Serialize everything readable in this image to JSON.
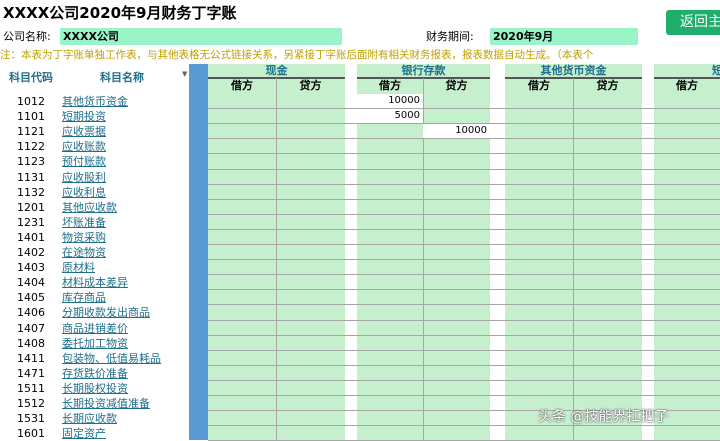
{
  "title": "XXXX公司2020年9月财务丁字账",
  "return_button": "返回主",
  "company_label": "公司名称:",
  "company_value": "XXXX公司",
  "period_label": "财务期间:",
  "period_value": "2020年9月",
  "notice": "注：本表为丁字账单独工作表，与其他表格无公式链接关系，另紧接丁字账后面附有相关财务报表，报表数据自动生成。（本表个",
  "headers": {
    "code": "科目代码",
    "name": "科目名称",
    "groups": [
      "现金",
      "银行存款",
      "其他货币资金",
      "短期"
    ],
    "debit": "借方",
    "credit": "贷方"
  },
  "accounts": [
    {
      "code": "1012",
      "name": "其他货币资金"
    },
    {
      "code": "1101",
      "name": "短期投资"
    },
    {
      "code": "1121",
      "name": "应收票据"
    },
    {
      "code": "1122",
      "name": "应收账款"
    },
    {
      "code": "1123",
      "name": "预付账款"
    },
    {
      "code": "1131",
      "name": "应收股利"
    },
    {
      "code": "1132",
      "name": "应收利息"
    },
    {
      "code": "1201",
      "name": "其他应收款"
    },
    {
      "code": "1231",
      "name": "坏账准备"
    },
    {
      "code": "1401",
      "name": "物资采购"
    },
    {
      "code": "1402",
      "name": "在途物资"
    },
    {
      "code": "1403",
      "name": "原材料"
    },
    {
      "code": "1404",
      "name": "材料成本差异"
    },
    {
      "code": "1405",
      "name": "库存商品"
    },
    {
      "code": "1406",
      "name": "分期收款发出商品"
    },
    {
      "code": "1407",
      "name": "商品进销差价"
    },
    {
      "code": "1408",
      "name": "委托加工物资"
    },
    {
      "code": "1411",
      "name": "包装物、低值易耗品"
    },
    {
      "code": "1471",
      "name": "存货跌价准备"
    },
    {
      "code": "1511",
      "name": "长期股权投资"
    },
    {
      "code": "1512",
      "name": "长期投资减值准备"
    },
    {
      "code": "1531",
      "name": "长期应收款"
    },
    {
      "code": "1601",
      "name": "固定资产"
    }
  ],
  "entries": {
    "bank_debit_row0": "10000",
    "bank_debit_row1": "5000",
    "bank_credit_row2": "10000"
  },
  "watermark": "头条 @技能界扛把子",
  "colors": {
    "accent_green": "#1fae6b",
    "cell_green": "#c6efce",
    "input_green": "#99f5c8",
    "blue_column": "#5b9bd5",
    "link_teal": "#1f6f8b",
    "notice_gold": "#c0a000"
  }
}
